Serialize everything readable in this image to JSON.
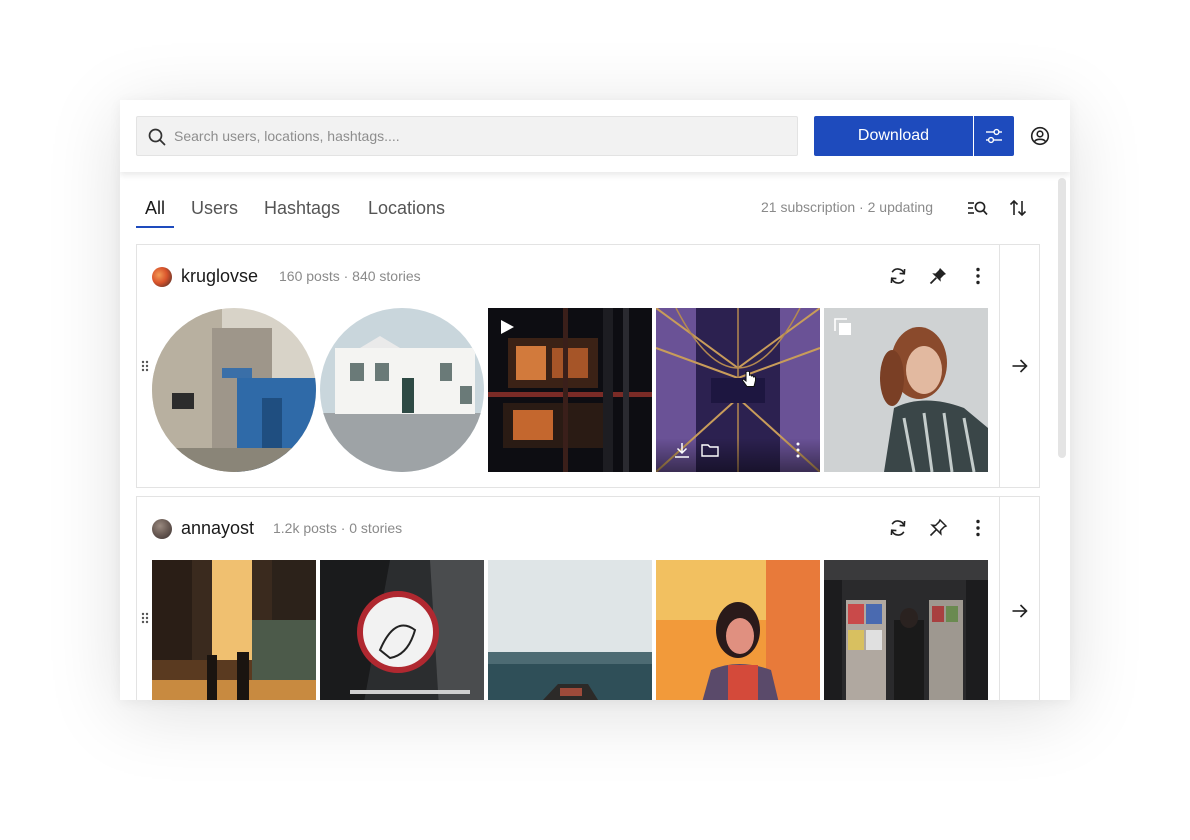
{
  "search": {
    "placeholder": "Search users, locations, hashtags...."
  },
  "toolbar": {
    "download_label": "Download",
    "settings_icon": "sliders-icon",
    "account_icon": "user-circle-icon",
    "accent_color": "#1e4bbd"
  },
  "tabs": [
    {
      "label": "All",
      "active": true
    },
    {
      "label": "Users",
      "active": false
    },
    {
      "label": "Hashtags",
      "active": false
    },
    {
      "label": "Locations",
      "active": false
    }
  ],
  "summary": {
    "text": "21 subscription · 2 updating",
    "search_list_icon": "list-search-icon",
    "sort_icon": "sort-arrows-icon"
  },
  "subscriptions": [
    {
      "username": "kruglovse",
      "stats": "160 posts · 840 stories",
      "actions": [
        "refresh-icon",
        "pin-filled-icon",
        "more-vertical-icon"
      ],
      "media": [
        {
          "kind": "story",
          "badge": ""
        },
        {
          "kind": "story",
          "badge": ""
        },
        {
          "kind": "video",
          "badge": "play-icon"
        },
        {
          "kind": "photo",
          "badge": "",
          "hovered": true,
          "hover_actions": [
            "download-icon",
            "folder-icon",
            "more-vertical-icon"
          ]
        },
        {
          "kind": "carousel",
          "badge": "gallery-icon"
        }
      ]
    },
    {
      "username": "annayost",
      "stats": "1.2k posts · 0 stories",
      "actions": [
        "refresh-icon",
        "pin-outline-icon",
        "more-vertical-icon"
      ],
      "media": [
        {
          "kind": "photo",
          "badge": ""
        },
        {
          "kind": "photo",
          "badge": ""
        },
        {
          "kind": "photo",
          "badge": ""
        },
        {
          "kind": "photo",
          "badge": ""
        },
        {
          "kind": "photo",
          "badge": ""
        }
      ]
    }
  ]
}
